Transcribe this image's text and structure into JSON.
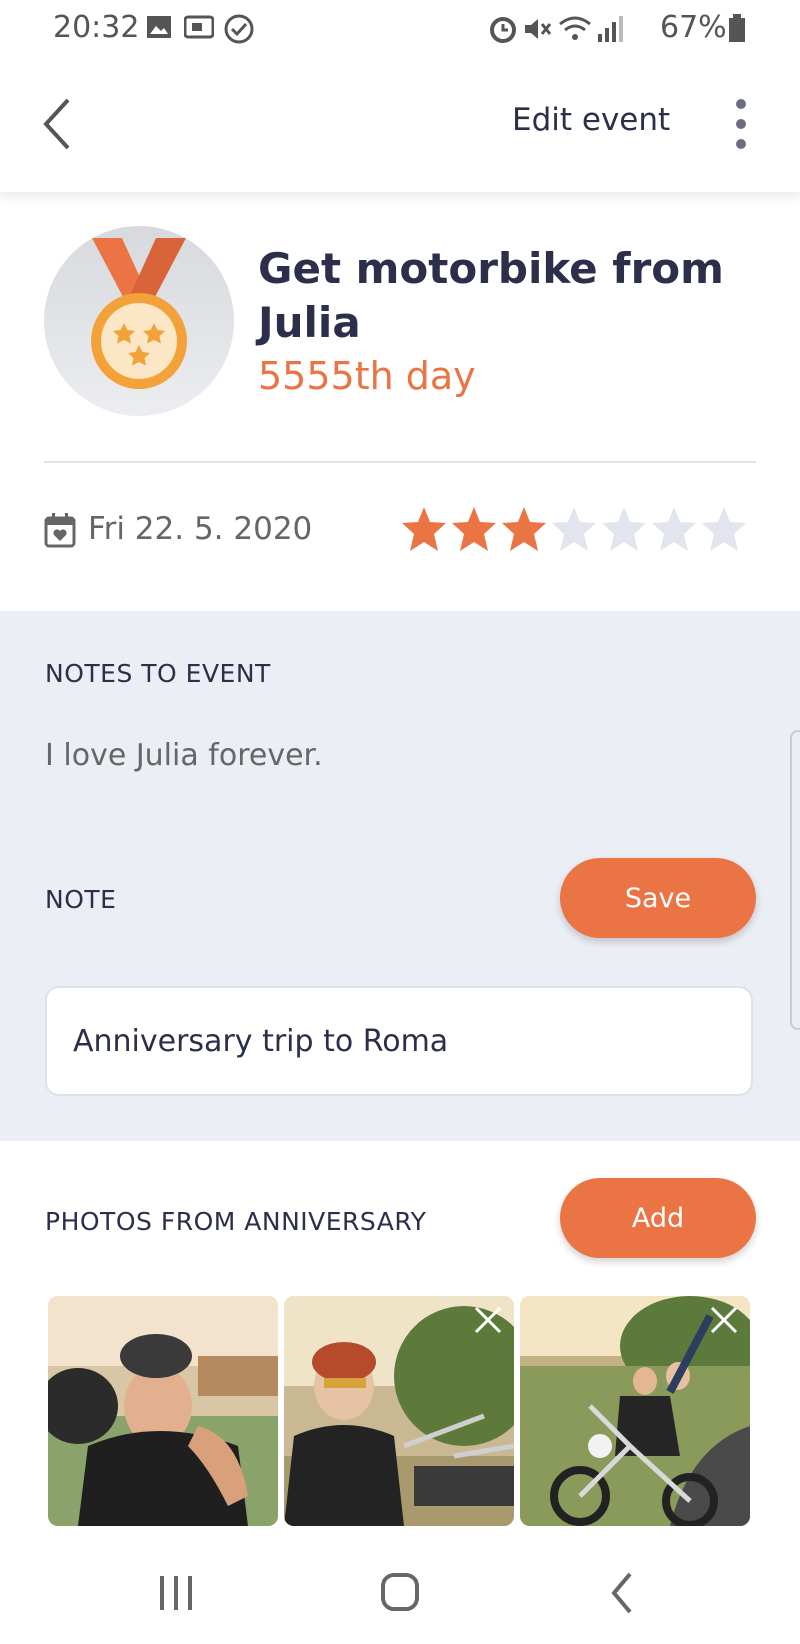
{
  "status_bar": {
    "time": "20:32",
    "battery": "67%",
    "icons": [
      "image-icon",
      "cast-icon",
      "check-circle-icon",
      "alarm-icon",
      "mute-icon",
      "wifi-icon",
      "signal-icon",
      "battery-icon"
    ]
  },
  "app_bar": {
    "edit_label": "Edit event",
    "back_icon": "chevron-left-icon",
    "more_icon": "more-vertical-icon"
  },
  "event": {
    "title": "Get motorbike from Julia",
    "day_label": "5555th day",
    "date": "Fri 22. 5. 2020",
    "rating": 3,
    "rating_max": 7,
    "icon": "medal-icon"
  },
  "notes": {
    "heading": "NOTES TO EVENT",
    "text": "I love Julia forever.",
    "note_label": "NOTE",
    "save_label": "Save",
    "input_value": "Anniversary trip to Roma"
  },
  "photos": {
    "heading": "PHOTOS FROM ANNIVERSARY",
    "add_label": "Add",
    "items": [
      "photo-couple-hug",
      "photo-man-helmet",
      "photo-couple-on-motorbike"
    ]
  },
  "colors": {
    "accent": "#ea7444",
    "text_dark": "#2b2f4a",
    "panel_bg": "#eceef5",
    "star_off": "#e3e5ee"
  }
}
